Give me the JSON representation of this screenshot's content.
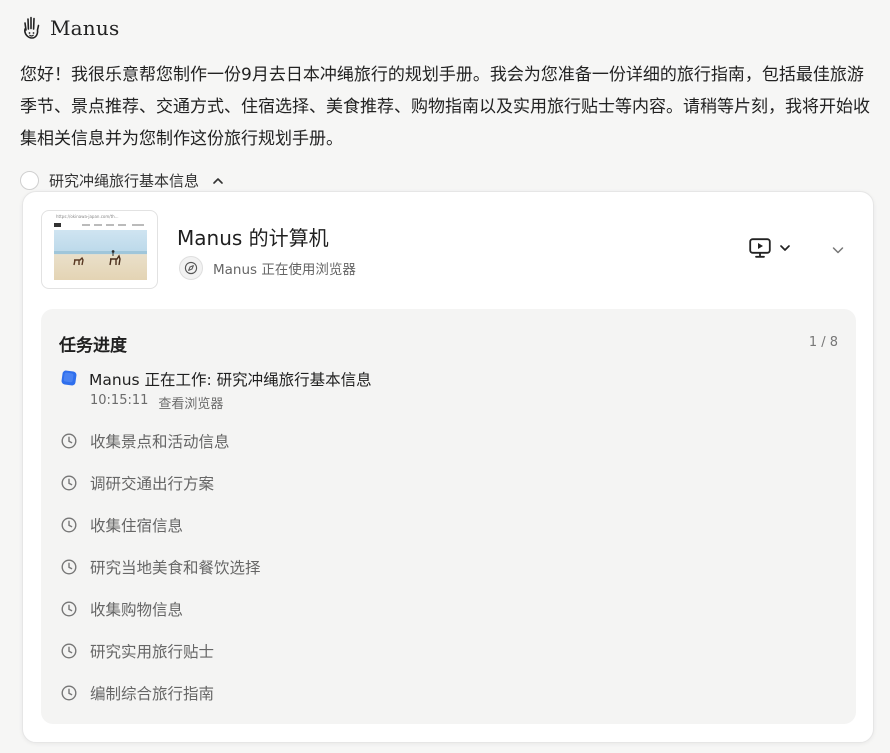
{
  "brand": {
    "name": "Manus",
    "logo_icon": "manus-hand-icon"
  },
  "message": {
    "text": "您好！我很乐意帮您制作一份9月去日本冲绳旅行的规划手册。我会为您准备一份详细的旅行指南，包括最佳旅游季节、景点推荐、交通方式、住宿选择、美食推荐、购物指南以及实用旅行贴士等内容。请稍等片刻，我将开始收集相关信息并为您制作这份旅行规划手册。"
  },
  "step": {
    "title": "研究冲绳旅行基本信息",
    "state_icon": "chevron-up-icon"
  },
  "computer": {
    "title": "Manus 的计算机",
    "status": "Manus 正在使用浏览器",
    "status_icon": "compass-icon",
    "thumbnail_url": "https://okinawa-japan.com/th...",
    "screen_icon": "screen-play-icon",
    "collapse_icon": "chevron-down-icon"
  },
  "progress": {
    "title": "任务进度",
    "count": "1 / 8",
    "active": {
      "text": "Manus 正在工作: 研究冲绳旅行基本信息",
      "time": "10:15:11",
      "link": "查看浏览器",
      "accent": "#2f6fed"
    },
    "tasks": [
      {
        "label": "收集景点和活动信息",
        "icon": "clock-icon"
      },
      {
        "label": "调研交通出行方案",
        "icon": "clock-icon"
      },
      {
        "label": "收集住宿信息",
        "icon": "clock-icon"
      },
      {
        "label": "研究当地美食和餐饮选择",
        "icon": "clock-icon"
      },
      {
        "label": "收集购物信息",
        "icon": "clock-icon"
      },
      {
        "label": "研究实用旅行贴士",
        "icon": "clock-icon"
      },
      {
        "label": "编制综合旅行指南",
        "icon": "clock-icon"
      }
    ]
  }
}
